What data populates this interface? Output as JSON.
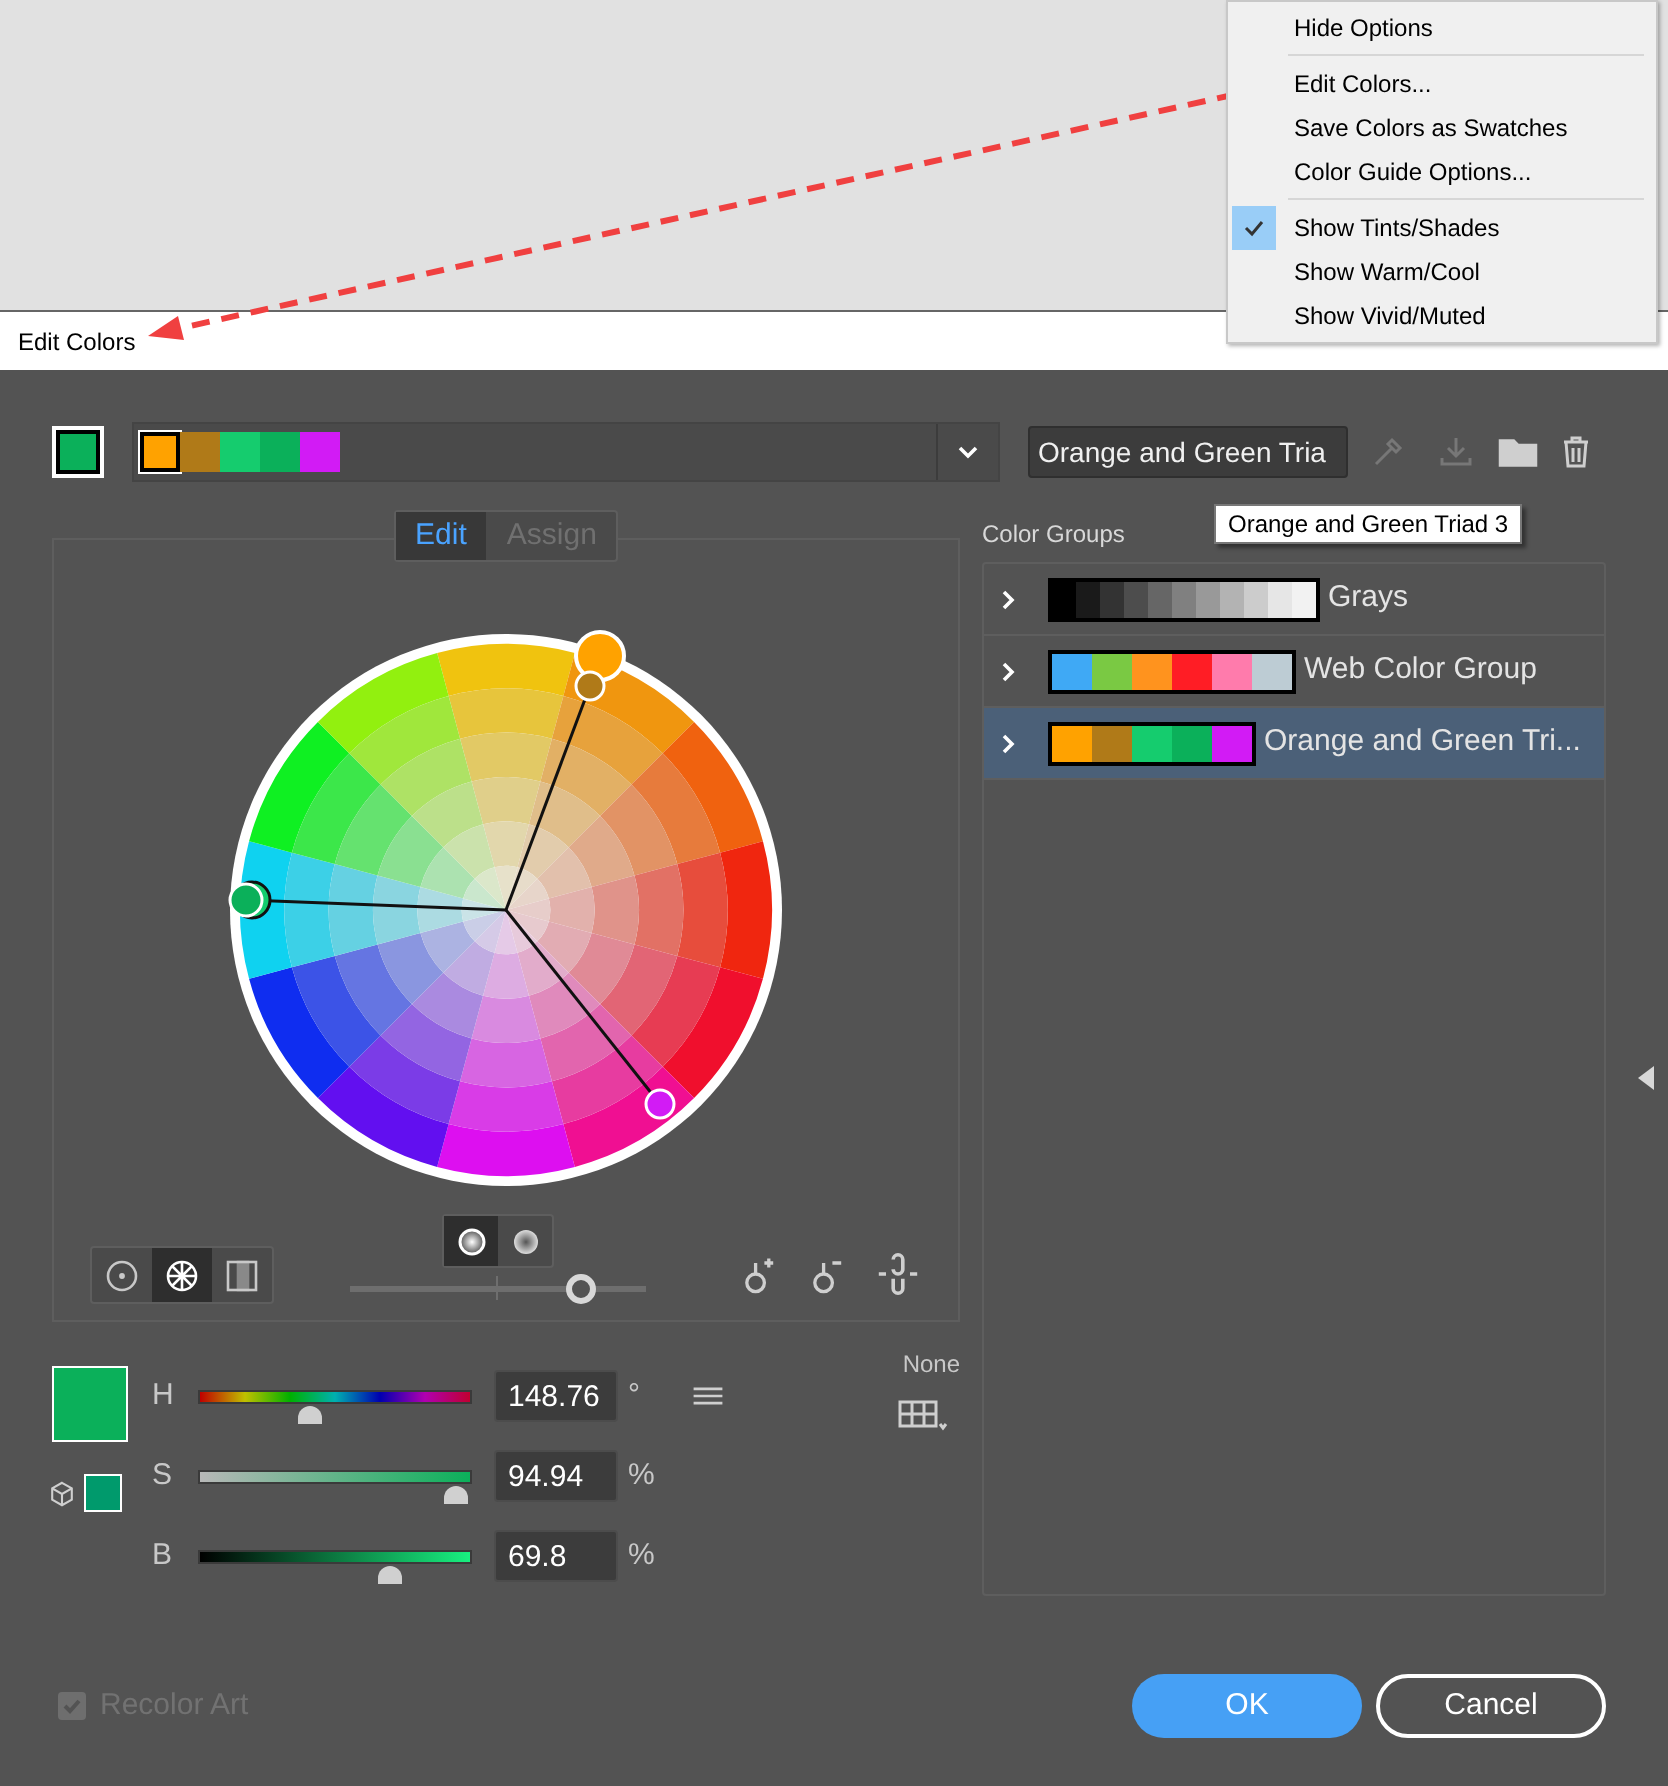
{
  "menu": {
    "sections": [
      {
        "items": [
          {
            "label": "Hide Options",
            "checked": false
          }
        ]
      },
      {
        "items": [
          {
            "label": "Edit Colors...",
            "checked": false
          },
          {
            "label": "Save Colors as Swatches",
            "checked": false
          },
          {
            "label": "Color Guide Options...",
            "checked": false
          }
        ]
      },
      {
        "items": [
          {
            "label": "Show Tints/Shades",
            "checked": true
          },
          {
            "label": "Show Warm/Cool",
            "checked": false
          },
          {
            "label": "Show Vivid/Muted",
            "checked": false
          }
        ]
      }
    ]
  },
  "dialog": {
    "title": "Edit Colors"
  },
  "active_colors": [
    {
      "color": "#ffa200",
      "selected": true
    },
    {
      "color": "#b07a18",
      "selected": false
    },
    {
      "color": "#15cc6e",
      "selected": false
    },
    {
      "color": "#0bb05a",
      "selected": false
    },
    {
      "color": "#d21bf5",
      "selected": false
    }
  ],
  "group_name": {
    "value": "Orange and Green Tria"
  },
  "tooltip": "Orange and Green Triad 3",
  "mode_tabs": [
    {
      "label": "Edit",
      "selected": true
    },
    {
      "label": "Assign",
      "selected": false
    }
  ],
  "wheel_views": [
    {
      "kind": "smooth",
      "selected": false
    },
    {
      "kind": "segmented",
      "selected": true
    },
    {
      "kind": "bars",
      "selected": false
    }
  ],
  "display_modes": [
    {
      "kind": "saturation",
      "selected": true
    },
    {
      "kind": "brightness",
      "selected": false
    }
  ],
  "wheel_slider": {
    "level": 0.78
  },
  "current_color": {
    "color": "#0bb05a"
  },
  "web_safe_color": {
    "color": "#009a6c"
  },
  "sliders": [
    {
      "kind": "hue",
      "label": "H",
      "level": 0.41,
      "value": "148.76",
      "unit": "°"
    },
    {
      "kind": "saturation",
      "label": "S",
      "level": 0.95,
      "value": "94.94",
      "unit": "%"
    },
    {
      "kind": "brightness",
      "label": "B",
      "level": 0.7,
      "value": "69.8",
      "unit": "%"
    }
  ],
  "limit": {
    "label": "None"
  },
  "color_groups": {
    "title": "Color Groups",
    "items": [
      {
        "name": "Grays",
        "selected": false,
        "swatches": [
          {
            "color": "#000000"
          },
          {
            "color": "#1a1a1a"
          },
          {
            "color": "#333333"
          },
          {
            "color": "#4d4d4d"
          },
          {
            "color": "#666666"
          },
          {
            "color": "#808080"
          },
          {
            "color": "#999999"
          },
          {
            "color": "#b3b3b3"
          },
          {
            "color": "#cccccc"
          },
          {
            "color": "#e6e6e6"
          },
          {
            "color": "#f2f2f2"
          }
        ]
      },
      {
        "name": "Web Color Group",
        "selected": false,
        "swatches": [
          {
            "color": "#3fa9f5"
          },
          {
            "color": "#7ac943"
          },
          {
            "color": "#ff931e"
          },
          {
            "color": "#ff1d25"
          },
          {
            "color": "#ff7bac"
          },
          {
            "color": "#bdccd4"
          }
        ]
      },
      {
        "name": "Orange and Green Tri...",
        "selected": true,
        "swatches": [
          {
            "color": "#ffa200"
          },
          {
            "color": "#b07a18"
          },
          {
            "color": "#15cc6e"
          },
          {
            "color": "#0bb05a"
          },
          {
            "color": "#d21bf5"
          }
        ]
      }
    ]
  },
  "recolor_art": {
    "label": "Recolor Art",
    "checked": true,
    "disabled": true
  },
  "buttons": [
    {
      "label": "OK",
      "kind": "primary"
    },
    {
      "label": "Cancel",
      "kind": "secondary"
    }
  ]
}
